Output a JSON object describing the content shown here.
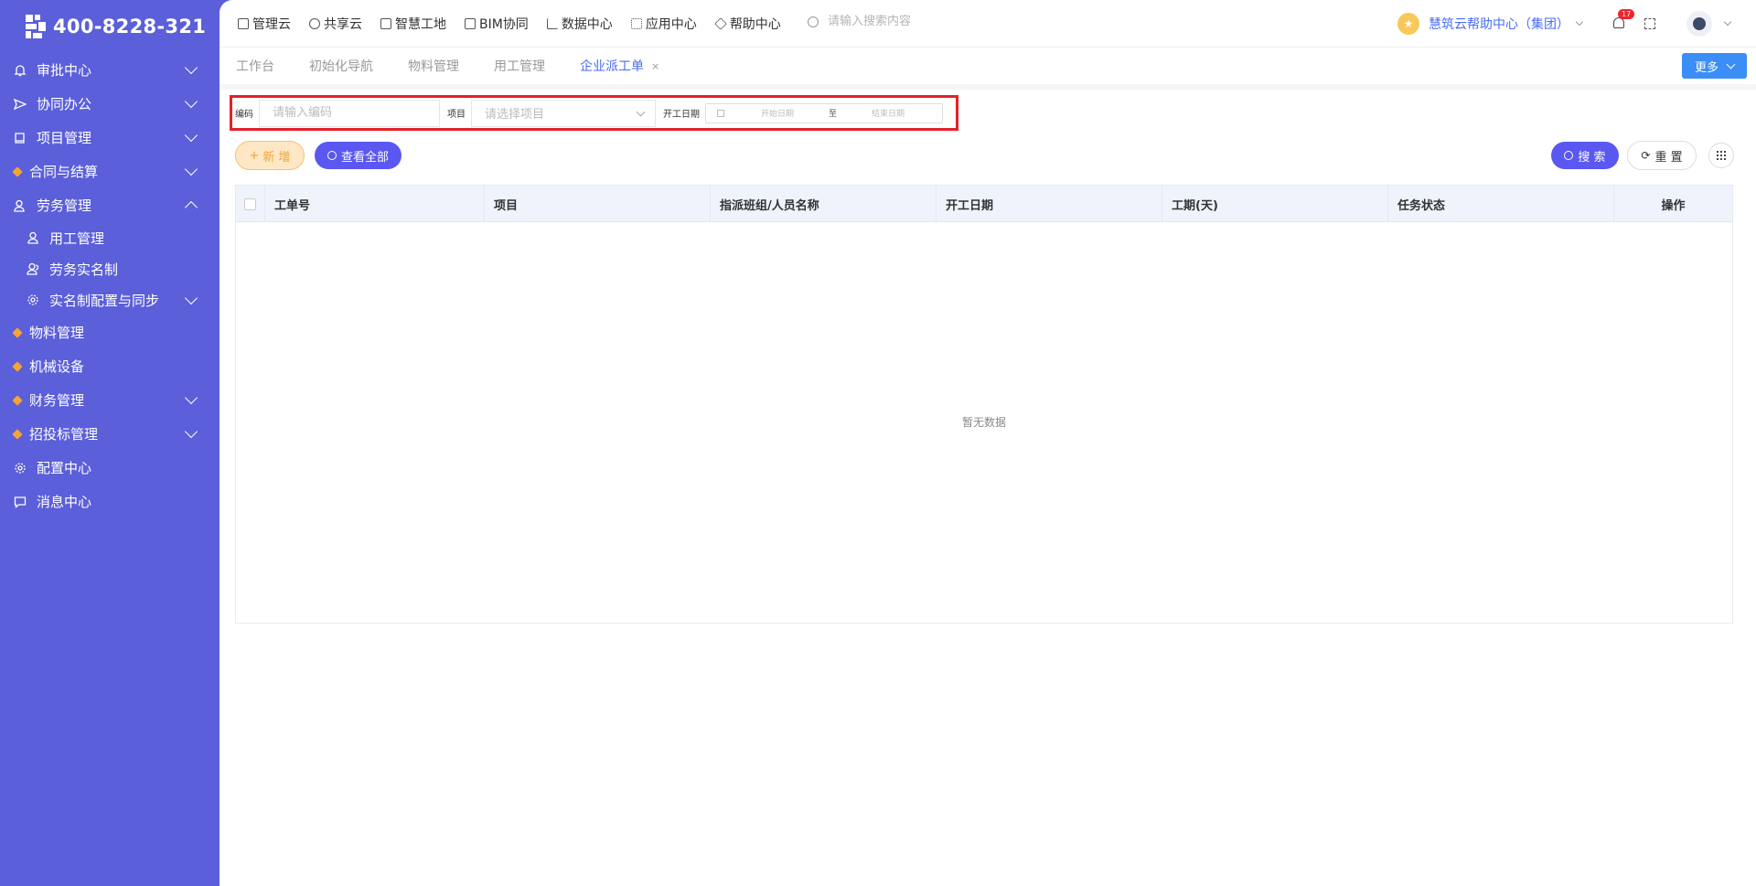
{
  "logo": {
    "text": "400-8228-321"
  },
  "sidebar": {
    "items": [
      {
        "label": "审批中心",
        "icon": "bell-icon",
        "expand": "down"
      },
      {
        "label": "协同办公",
        "icon": "send-icon",
        "expand": "down"
      },
      {
        "label": "项目管理",
        "icon": "book-icon",
        "expand": "down"
      },
      {
        "label": "合同与结算",
        "icon": "gem-icon",
        "expand": "down"
      },
      {
        "label": "劳务管理",
        "icon": "user-icon",
        "expand": "up"
      }
    ],
    "sub_items": [
      {
        "label": "用工管理",
        "icon": "user-icon"
      },
      {
        "label": "劳务实名制",
        "icon": "users-icon"
      },
      {
        "label": "实名制配置与同步",
        "icon": "gear-icon",
        "expand": "down"
      }
    ],
    "items_after": [
      {
        "label": "物料管理",
        "icon": "gem-icon"
      },
      {
        "label": "机械设备",
        "icon": "gem-icon"
      },
      {
        "label": "财务管理",
        "icon": "gem-icon",
        "expand": "down"
      },
      {
        "label": "招投标管理",
        "icon": "gem-icon",
        "expand": "down"
      },
      {
        "label": "配置中心",
        "icon": "gear-icon"
      },
      {
        "label": "消息中心",
        "icon": "message-icon"
      }
    ]
  },
  "topnav": {
    "items": [
      "管理云",
      "共享云",
      "智慧工地",
      "BIM协同",
      "数据中心",
      "应用中心",
      "帮助中心"
    ],
    "search_placeholder": "请输入搜索内容",
    "org_name": "慧筑云帮助中心（集团）",
    "notification_count": "17"
  },
  "tabs": {
    "items": [
      "工作台",
      "初始化导航",
      "物料管理",
      "用工管理",
      "企业派工单"
    ],
    "active_index": 4,
    "more_label": "更多"
  },
  "filter": {
    "code_label": "编码",
    "code_placeholder": "请输入编码",
    "project_label": "项目",
    "project_placeholder": "请选择项目",
    "date_label": "开工日期",
    "start_placeholder": "开始日期",
    "range_sep": "至",
    "end_placeholder": "结束日期"
  },
  "actions": {
    "add_label": "新 增",
    "view_all_label": "查看全部",
    "search_label": "搜 索",
    "reset_label": "重 置"
  },
  "table": {
    "columns": [
      "工单号",
      "项目",
      "指派班组/人员名称",
      "开工日期",
      "工期(天)",
      "任务状态",
      "操作"
    ],
    "empty_text": "暂无数据"
  },
  "colors": {
    "sidebar_bg": "#5b5fd9",
    "primary": "#5a58f0",
    "accent_blue": "#3a8ef6",
    "highlight_border": "#e5202a",
    "add_bg": "#fde7c4"
  }
}
